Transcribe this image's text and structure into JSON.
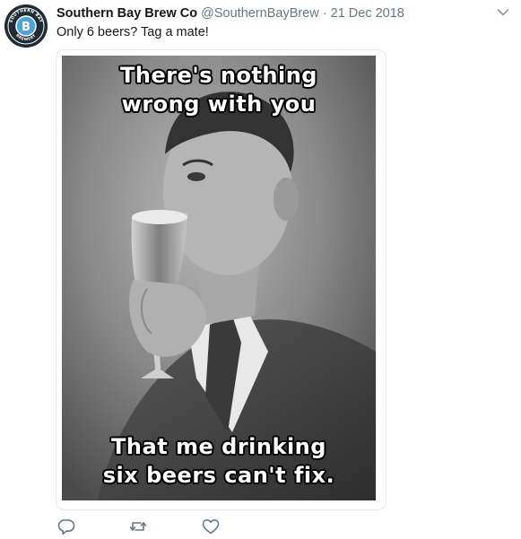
{
  "tweet": {
    "author_name": "Southern Bay Brew Co",
    "handle": "@SouthernBayBrew",
    "separator": "·",
    "date": "21 Dec 2018",
    "text": "Only 6 beers? Tag a mate!"
  },
  "avatar": {
    "logo_top_text": "SOUTHERN BAY",
    "logo_letter": "B",
    "logo_bottom_text": "BREWERY"
  },
  "media": {
    "meme_top_line1": "There's nothing",
    "meme_top_line2": "wrong with you",
    "meme_bottom_line1": "That me drinking",
    "meme_bottom_line2": "six beers can't fix."
  },
  "actions": [
    "reply-icon",
    "retweet-icon",
    "like-icon"
  ],
  "icons": {
    "menu": "chevron-down-icon"
  },
  "colors": {
    "text": "#14171a",
    "secondary": "#657786",
    "border": "#e1e8ed"
  }
}
